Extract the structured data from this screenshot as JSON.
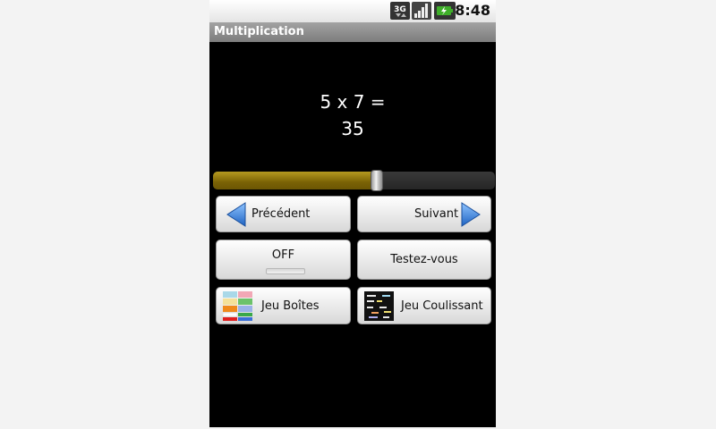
{
  "status_bar": {
    "time": "8:48",
    "network_label": "3G",
    "icons": [
      "network-3g-icon",
      "signal-icon",
      "battery-charging-icon"
    ]
  },
  "title_bar": {
    "title": "Multiplication"
  },
  "equation": {
    "line1": "5 x 7 =",
    "line2": "35"
  },
  "seekbar": {
    "level_fraction": 0.58
  },
  "buttons": {
    "previous": "Précédent",
    "next": "Suivant",
    "toggle": "OFF",
    "test": "Testez-vous",
    "boxes_game": "Jeu Boîtes",
    "sliding_game": "Jeu Coulissant"
  },
  "colors": {
    "seek_fill": "#8a7008",
    "arrow_blue": "#2f7fd8",
    "background": "#000000"
  }
}
